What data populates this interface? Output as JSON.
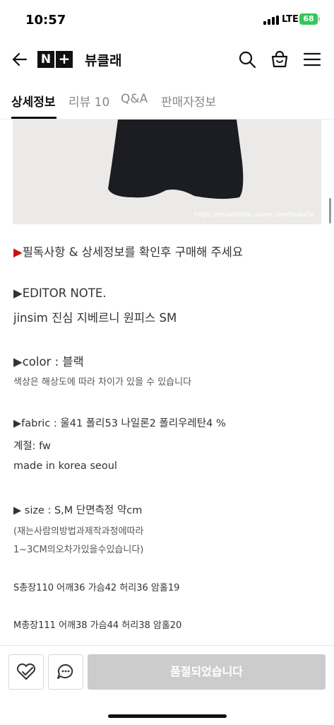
{
  "status_bar": {
    "time": "10:57",
    "network": "LTE",
    "battery": "68"
  },
  "header": {
    "logo_n": "N",
    "logo_plus": "+",
    "store_name": "뷰클래"
  },
  "tabs": [
    {
      "label": "상세정보",
      "active": true
    },
    {
      "label": "리뷰 10",
      "active": false
    },
    {
      "label": "Q&A",
      "active": false
    },
    {
      "label": "판매자정보",
      "active": false
    }
  ],
  "image": {
    "watermark": "https://smartstore.naver.com/beaucla"
  },
  "description": {
    "notice_marker": "▶",
    "notice": "필독사항 & 상세정보를 확인후 구매해 주세요",
    "editor_note_heading": "▶EDITOR NOTE.",
    "editor_note_text": "jinsim 진심 지베르니 원피스 SM",
    "color_label": "▶color : 블랙",
    "color_note": "색상은 해상도에 따라 차이가 있을 수 있습니다",
    "fabric_label": "▶fabric : 울41 폴리53 나일론2 폴리우레탄4 %",
    "season": "계절: fw",
    "origin": "made in korea seoul",
    "size_label": "▶ size : S,M 단면측정 약cm",
    "size_note_1": "(재는사람의방법과제작과정에따라",
    "size_note_2": "1~3CM의오차가있을수있습니다)",
    "size_s": "S총장110 어깨36 가슴42 허리36 암홀19",
    "size_m": "M총장111 어깨38 가슴44 허리38 암홀20"
  },
  "bottom_bar": {
    "soldout_label": "품절되었습니다"
  },
  "colors": {
    "accent_red": "#cc1100",
    "battery_green": "#34c759",
    "disabled_button": "#cccccc"
  }
}
